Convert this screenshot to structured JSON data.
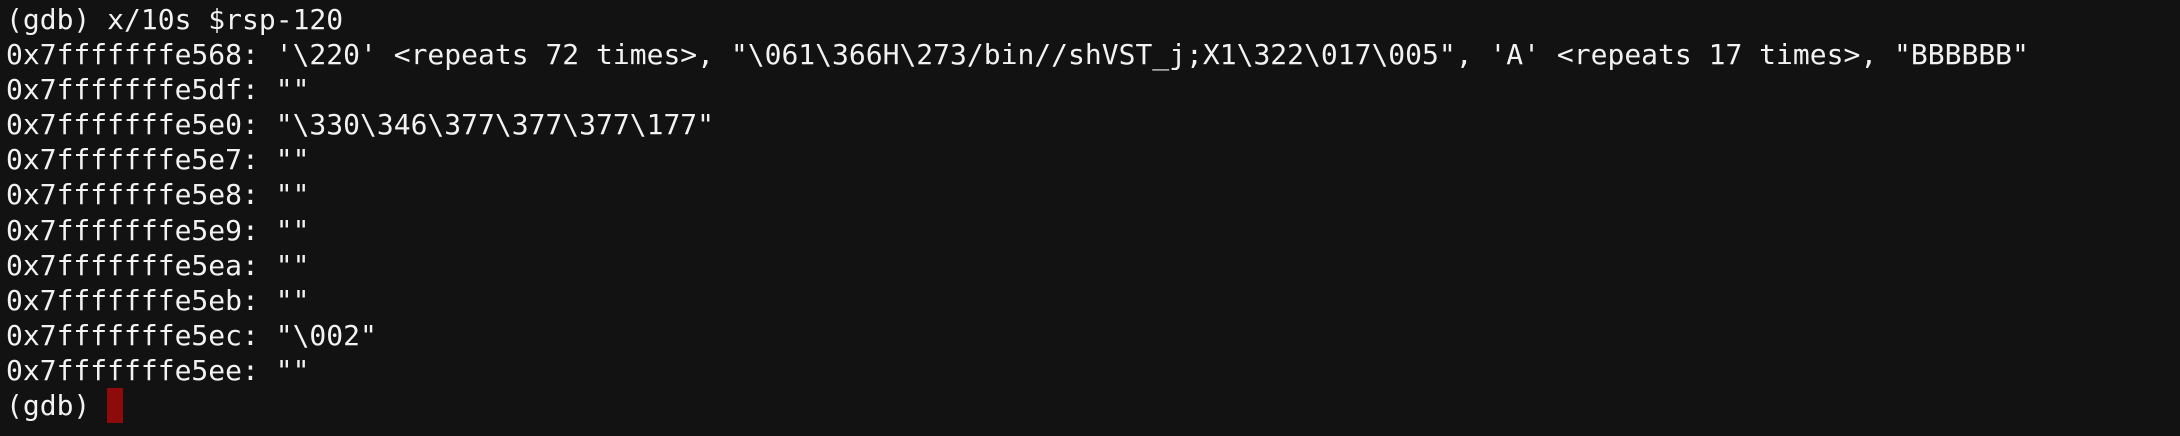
{
  "terminal": {
    "command_line": "(gdb) x/10s $rsp-120",
    "output_lines": [
      "0x7fffffffe568: '\\220' <repeats 72 times>, \"\\061\\366H\\273/bin//shVST_j;X1\\322\\017\\005\", 'A' <repeats 17 times>, \"BBBBBB\"",
      "0x7fffffffe5df: \"\"",
      "0x7fffffffe5e0: \"\\330\\346\\377\\377\\377\\177\"",
      "0x7fffffffe5e7: \"\"",
      "0x7fffffffe5e8: \"\"",
      "0x7fffffffe5e9: \"\"",
      "0x7fffffffe5ea: \"\"",
      "0x7fffffffe5eb: \"\"",
      "0x7fffffffe5ec: \"\\002\"",
      "0x7fffffffe5ee: \"\""
    ],
    "prompt": "(gdb)",
    "cursor_color": "#8f0a0a",
    "background_color": "#121212",
    "text_color": "#f2f2f2"
  }
}
